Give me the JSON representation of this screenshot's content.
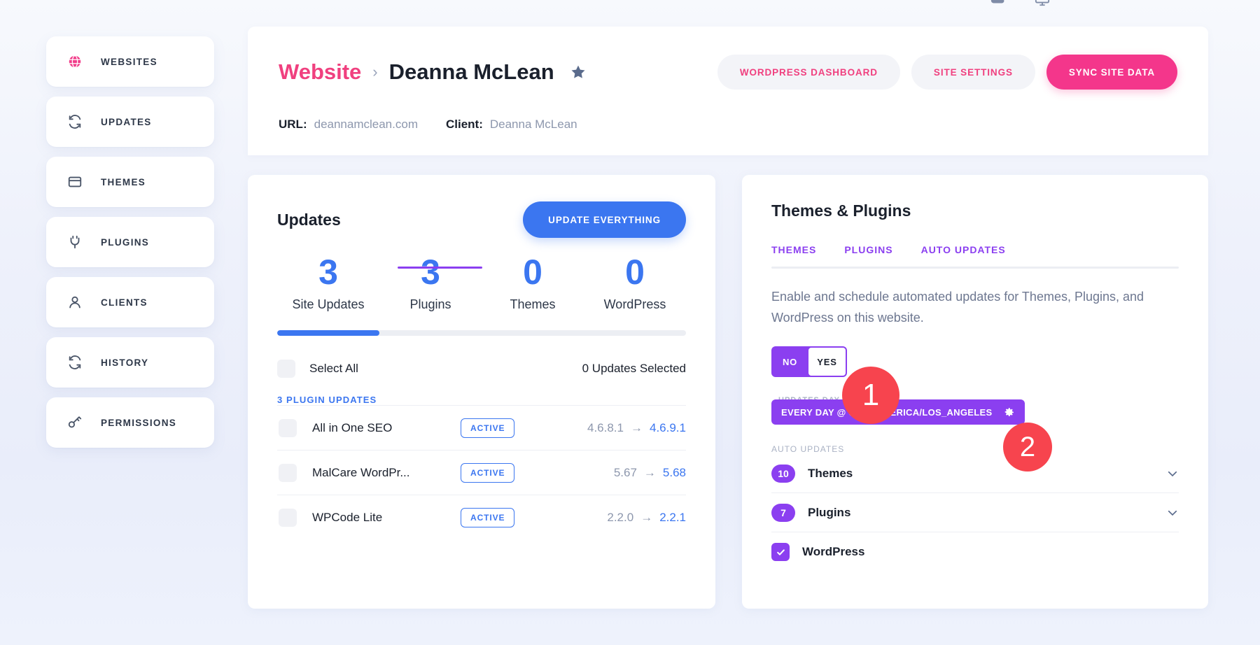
{
  "topbar": {
    "icons": [
      "cloud-icon",
      "monitor-icon"
    ]
  },
  "sidebar": {
    "items": [
      {
        "label": "WEBSITES",
        "icon": "globe-icon",
        "active": true
      },
      {
        "label": "UPDATES",
        "icon": "refresh-icon",
        "active": false
      },
      {
        "label": "THEMES",
        "icon": "window-icon",
        "active": false
      },
      {
        "label": "PLUGINS",
        "icon": "plug-icon",
        "active": false
      },
      {
        "label": "CLIENTS",
        "icon": "user-icon",
        "active": false
      },
      {
        "label": "HISTORY",
        "icon": "refresh-icon",
        "active": false
      },
      {
        "label": "PERMISSIONS",
        "icon": "key-icon",
        "active": false
      }
    ]
  },
  "header": {
    "breadcrumb_root": "Website",
    "breadcrumb_separator": "›",
    "breadcrumb_current": "Deanna McLean",
    "favorite_icon": "star-icon",
    "actions": [
      {
        "label": "WORDPRESS DASHBOARD",
        "style": "ghost"
      },
      {
        "label": "SITE SETTINGS",
        "style": "ghost"
      },
      {
        "label": "SYNC SITE DATA",
        "style": "solid"
      }
    ],
    "meta": [
      {
        "key": "URL:",
        "value": "deannamclean.com"
      },
      {
        "key": "Client:",
        "value": "Deanna McLean"
      }
    ]
  },
  "updates_card": {
    "title": "Updates",
    "update_everything_label": "UPDATE EVERYTHING",
    "stats": [
      {
        "value": "3",
        "label": "Site Updates"
      },
      {
        "value": "3",
        "label": "Plugins"
      },
      {
        "value": "0",
        "label": "Themes"
      },
      {
        "value": "0",
        "label": "WordPress"
      }
    ],
    "progress_percent": 25,
    "select_all_label": "Select All",
    "selected_count_label": "0 Updates Selected",
    "group_title": "3 PLUGIN UPDATES",
    "version_arrow": "→",
    "rows": [
      {
        "name": "All in One SEO",
        "status": "ACTIVE",
        "from": "4.6.8.1",
        "to": "4.6.9.1"
      },
      {
        "name": "MalCare WordPr...",
        "status": "ACTIVE",
        "from": "5.67",
        "to": "5.68"
      },
      {
        "name": "WPCode Lite",
        "status": "ACTIVE",
        "from": "2.2.0",
        "to": "2.2.1"
      }
    ]
  },
  "themes_plugins_card": {
    "title": "Themes & Plugins",
    "tabs": [
      {
        "label": "THEMES",
        "active": false
      },
      {
        "label": "PLUGINS",
        "active": false
      },
      {
        "label": "AUTO UPDATES",
        "active": true
      }
    ],
    "description": "Enable and schedule automated updates for Themes, Plugins, and WordPress on this website.",
    "toggle": {
      "off_label": "NO",
      "on_label": "YES",
      "selected": "YES"
    },
    "schedule": {
      "field_label": "UPDATES DAY & TIME",
      "value": "EVERY DAY @ 00:00  AMERICA/LOS_ANGELES",
      "settings_icon": "gear-icon"
    },
    "auto_updates_caption": "AUTO UPDATES",
    "auto_rows": [
      {
        "name": "Themes",
        "count": "10",
        "type": "count",
        "expand_icon": "chevron-down-icon"
      },
      {
        "name": "Plugins",
        "count": "7",
        "type": "count",
        "expand_icon": "chevron-down-icon"
      },
      {
        "name": "WordPress",
        "count": "",
        "type": "checkbox",
        "expand_icon": ""
      }
    ]
  },
  "annotations": [
    {
      "number": "1",
      "target": "auto-updates-toggle"
    },
    {
      "number": "2",
      "target": "schedule-pill"
    }
  ],
  "colors": {
    "brand_pink": "#f0407f",
    "accent_blue": "#3b76f0",
    "accent_purple": "#8b3ff0",
    "annotation_red": "#f7444e",
    "page_bg": "#eef1fb"
  }
}
